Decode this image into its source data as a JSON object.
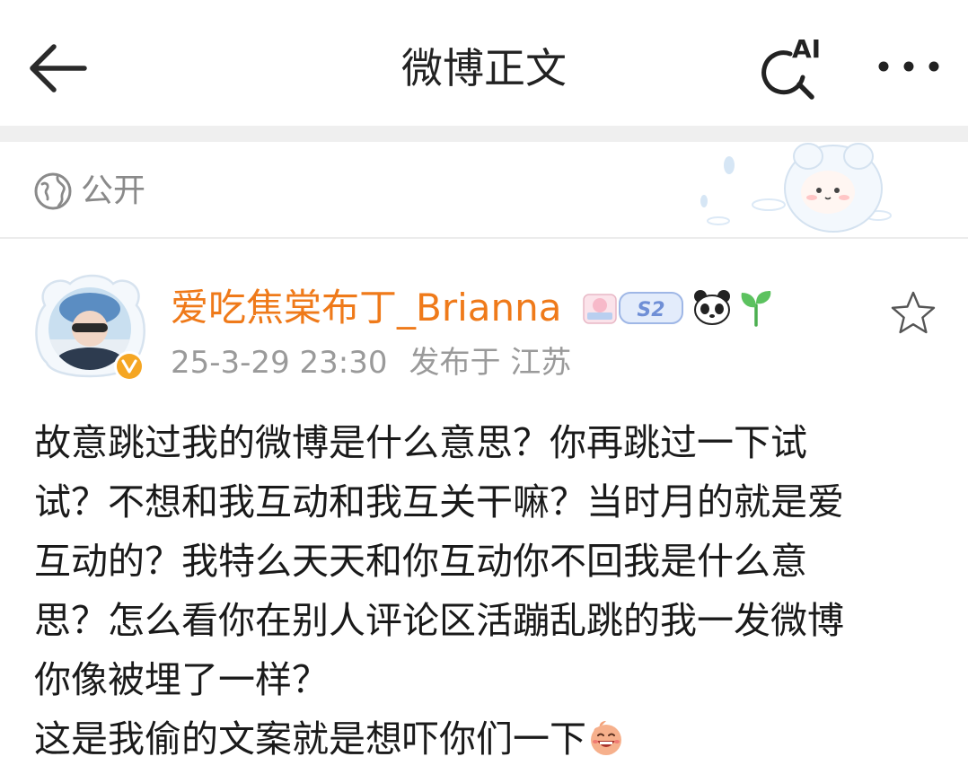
{
  "nav": {
    "title": "微博正文",
    "ai_label": "AI"
  },
  "visibility": {
    "label": "公开"
  },
  "post": {
    "author": "爱吃焦棠布丁_Brianna",
    "badge_text": "S2",
    "timestamp": "25-3-29 23:30",
    "location": "发布于 江苏",
    "body_lines": [
      "故意跳过我的微博是什么意思？你再跳过一下试",
      "试？不想和我互动和我互关干嘛？当时月的就是爱",
      "互动的？我特么天天和你互动你不回我是什么意",
      "思？怎么看你在别人评论区活蹦乱跳的我一发微博",
      "你像被埋了一样？"
    ],
    "last_line": "这是我偷的文案就是想吓你们一下"
  },
  "colors": {
    "author_name": "#ef7a1a",
    "verified_badge": "#f5a623",
    "meta_text": "#9a9a9a"
  },
  "icons": [
    "back-arrow-icon",
    "ai-search-icon",
    "more-icon",
    "globe-icon",
    "verified-icon",
    "star-icon",
    "panda-icon",
    "sprout-icon",
    "laugh-emoji-icon"
  ]
}
